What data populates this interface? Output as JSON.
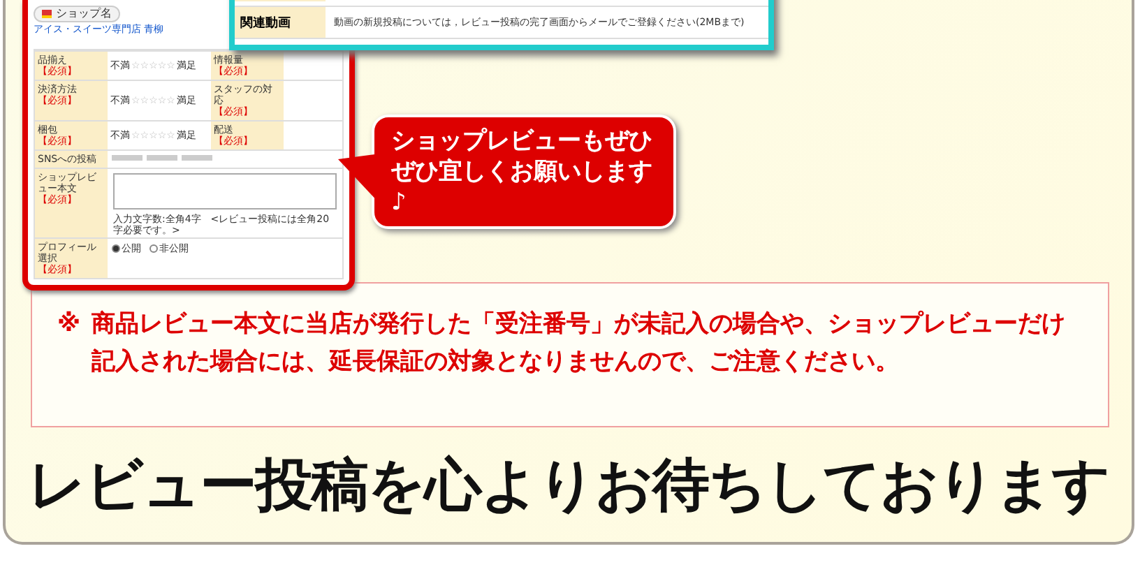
{
  "form_screenshot": {
    "shop_name": "ショップ名",
    "shop_link": "アイス・スイーツ専門店 青柳",
    "rating_rows": [
      {
        "label": "品揃え",
        "required": "【必須】",
        "low": "不満",
        "high": "満足",
        "stars": 0,
        "label_2": "情報量",
        "required_2": "【必須】"
      },
      {
        "label": "決済方法",
        "required": "【必須】",
        "low": "不満",
        "high": "満足",
        "stars": 0,
        "label_2": "スタッフの対応",
        "required_2": "【必須】"
      },
      {
        "label": "梱包",
        "required": "【必須】",
        "low": "不満",
        "high": "満足",
        "stars": 0,
        "label_2": "配送",
        "required_2": "【必須】"
      }
    ],
    "sns_label": "SNSへの投稿",
    "review_label": "ショップレビュー本文",
    "review_required": "【必須】",
    "review_hint": "入力文字数:全角4字　<レビュー投稿には全角20字必要です。>",
    "profile_label": "プロフィール選択",
    "profile_required": "【必須】",
    "profile_options": [
      {
        "label": "公開",
        "selected": true
      },
      {
        "label": "非公開",
        "selected": false
      }
    ]
  },
  "video_window": {
    "label": "関連動画",
    "text": "動画の新規投稿については，レビュー投稿の完了画面からメールでご登録ください(2MBまで)"
  },
  "callout": "ショップレビューもぜひぜひ宜しくお願いします♪",
  "notice": {
    "mark": "※",
    "text": "商品レビュー本文に当店が発行した「受注番号」が未記入の場合や、ショップレビューだけ記入された場合には、延長保証の対象となりませんので、ご注意ください。"
  },
  "heading": "レビュー投稿を心よりお待ちしております"
}
